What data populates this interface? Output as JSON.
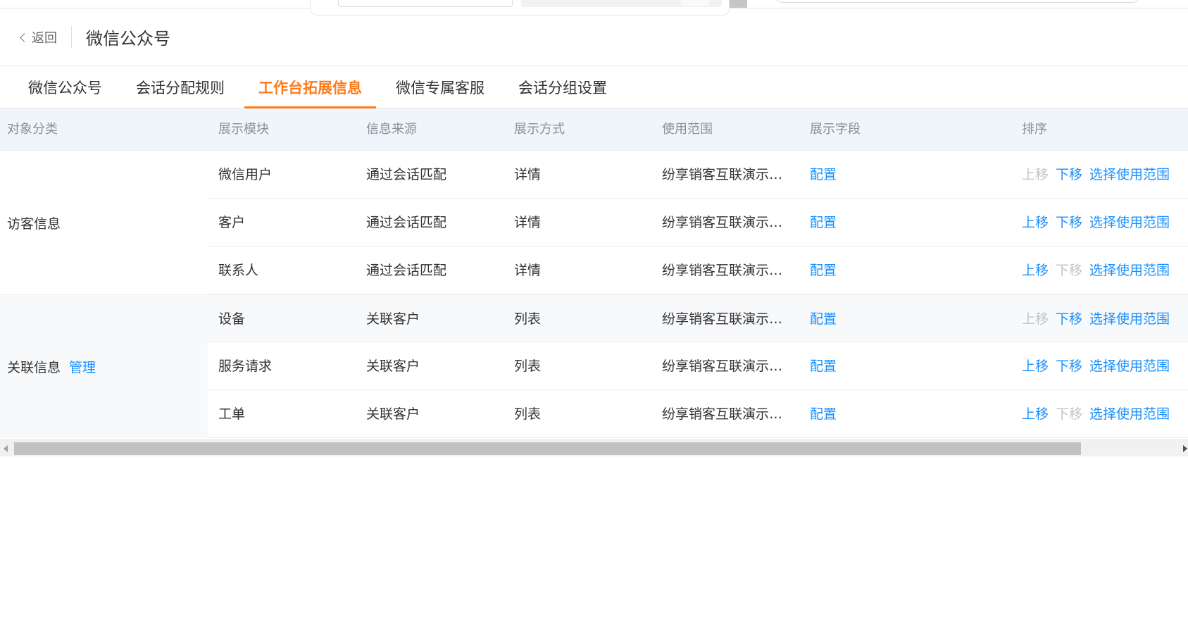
{
  "header": {
    "back_label": "返回",
    "title": "微信公众号"
  },
  "tabs": [
    {
      "label": "微信公众号",
      "active": false
    },
    {
      "label": "会话分配规则",
      "active": false
    },
    {
      "label": "工作台拓展信息",
      "active": true
    },
    {
      "label": "微信专属客服",
      "active": false
    },
    {
      "label": "会话分组设置",
      "active": false
    }
  ],
  "table": {
    "columns": [
      "对象分类",
      "展示模块",
      "信息来源",
      "展示方式",
      "使用范围",
      "展示字段",
      "排序"
    ],
    "groups": [
      {
        "label": "访客信息",
        "manage": ""
      },
      {
        "label": "关联信息",
        "manage": "管理"
      }
    ],
    "rows": [
      {
        "module": "微信用户",
        "source": "通过会话匹配",
        "mode": "详情",
        "scope": "纷享销客互联演示企业",
        "field": "配置",
        "up": "上移",
        "down": "下移",
        "range": "选择使用范围",
        "up_disabled": true,
        "down_disabled": false
      },
      {
        "module": "客户",
        "source": "通过会话匹配",
        "mode": "详情",
        "scope": "纷享销客互联演示企业",
        "field": "配置",
        "up": "上移",
        "down": "下移",
        "range": "选择使用范围",
        "up_disabled": false,
        "down_disabled": false
      },
      {
        "module": "联系人",
        "source": "通过会话匹配",
        "mode": "详情",
        "scope": "纷享销客互联演示企业",
        "field": "配置",
        "up": "上移",
        "down": "下移",
        "range": "选择使用范围",
        "up_disabled": false,
        "down_disabled": true
      },
      {
        "module": "设备",
        "source": "关联客户",
        "mode": "列表",
        "scope": "纷享销客互联演示企业",
        "field": "配置",
        "up": "上移",
        "down": "下移",
        "range": "选择使用范围",
        "up_disabled": true,
        "down_disabled": false
      },
      {
        "module": "服务请求",
        "source": "关联客户",
        "mode": "列表",
        "scope": "纷享销客互联演示企业",
        "field": "配置",
        "up": "上移",
        "down": "下移",
        "range": "选择使用范围",
        "up_disabled": false,
        "down_disabled": false
      },
      {
        "module": "工单",
        "source": "关联客户",
        "mode": "列表",
        "scope": "纷享销客互联演示企业",
        "field": "配置",
        "up": "上移",
        "down": "下移",
        "range": "选择使用范围",
        "up_disabled": false,
        "down_disabled": true
      }
    ]
  },
  "colors": {
    "accent": "#ff7a1a",
    "link": "#1890ff",
    "disabled": "#c0c4cc",
    "header_bg": "#f0f4fb"
  }
}
